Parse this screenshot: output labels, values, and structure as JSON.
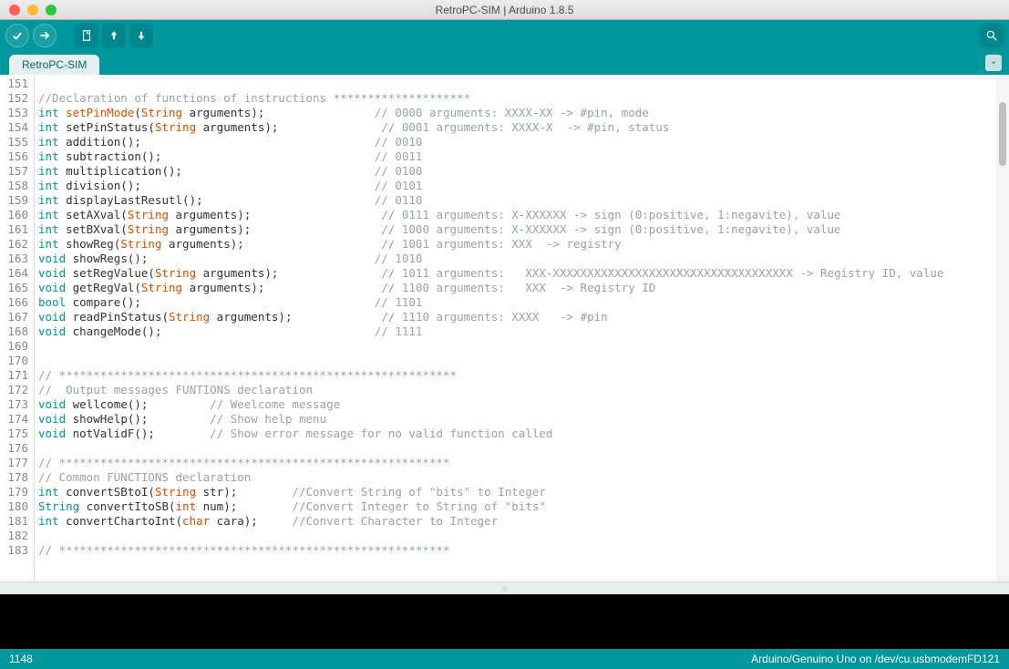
{
  "window": {
    "title": "RetroPC-SIM | Arduino 1.8.5"
  },
  "tab": {
    "name": "RetroPC-SIM"
  },
  "status": {
    "left": "1148",
    "right": "Arduino/Genuino Uno on /dev/cu.usbmodemFD121"
  },
  "first_line": 151,
  "code_lines": [
    {
      "plain": " "
    },
    {
      "cm": "//Declaration of functions of instructions ********************"
    },
    {
      "kw": "int",
      "plain": " ",
      "fn": "setPinMode",
      "after": "(",
      "tp": "String",
      "args": " arguments);",
      "spacer": "                ",
      "cm": "// 0000 arguments: XXXX-XX -> #pin, mode"
    },
    {
      "kw": "int",
      "plain": " setPinStatus(",
      "tp": "String",
      "args": " arguments);",
      "spacer": "               ",
      "cm": "// 0001 arguments: XXXX-X  -> #pin, status"
    },
    {
      "kw": "int",
      "plain": " addition();",
      "spacer": "                                  ",
      "cm": "// 0010"
    },
    {
      "kw": "int",
      "plain": " subtraction();",
      "spacer": "                               ",
      "cm": "// 0011"
    },
    {
      "kw": "int",
      "plain": " multiplication();",
      "spacer": "                            ",
      "cm": "// 0100"
    },
    {
      "kw": "int",
      "plain": " division();",
      "spacer": "                                  ",
      "cm": "// 0101"
    },
    {
      "kw": "int",
      "plain": " displayLastResutl();",
      "spacer": "                         ",
      "cm": "// 0110"
    },
    {
      "kw": "int",
      "plain": " setAXval(",
      "tp": "String",
      "args": " arguments);",
      "spacer": "                   ",
      "cm": "// 0111 arguments: X-XXXXXX -> sign (0:positive, 1:negavite), value"
    },
    {
      "kw": "int",
      "plain": " setBXval(",
      "tp": "String",
      "args": " arguments);",
      "spacer": "                   ",
      "cm": "// 1000 arguments: X-XXXXXX -> sign (0:positive, 1:negavite), value"
    },
    {
      "kw": "int",
      "plain": " showReg(",
      "tp": "String",
      "args": " arguments);",
      "spacer": "                    ",
      "cm": "// 1001 arguments: XXX  -> registry"
    },
    {
      "kw": "void",
      "plain": " showRegs();",
      "spacer": "                                 ",
      "cm": "// 1010"
    },
    {
      "kw": "void",
      "plain": " setRegValue(",
      "tp": "String",
      "args": " arguments);",
      "spacer": "               ",
      "cm": "// 1011 arguments:   XXX-XXXXXXXXXXXXXXXXXXXXXXXXXXXXXXXXXXX -> Registry ID, value"
    },
    {
      "kw": "void",
      "plain": " getRegVal(",
      "tp": "String",
      "args": " arguments);",
      "spacer": "                 ",
      "cm": "// 1100 arguments:   XXX  -> Registry ID"
    },
    {
      "kw": "bool",
      "plain": " compare();",
      "spacer": "                                  ",
      "cm": "// 1101"
    },
    {
      "kw": "void",
      "plain": " readPinStatus(",
      "tp": "String",
      "args": " arguments);",
      "spacer": "             ",
      "cm": "// 1110 arguments: XXXX   -> #pin"
    },
    {
      "kw": "void",
      "plain": " changeMode();",
      "spacer": "                               ",
      "cm": "// 1111"
    },
    {
      "plain": " "
    },
    {
      "plain": " "
    },
    {
      "cm": "// **********************************************************"
    },
    {
      "cm": "//  Output messages FUNTIONS declaration"
    },
    {
      "kw": "void",
      "plain": " wellcome();",
      "spacer": "         ",
      "cm": "// Weelcome message"
    },
    {
      "kw": "void",
      "plain": " showHelp();",
      "spacer": "         ",
      "cm": "// Show help menu"
    },
    {
      "kw": "void",
      "plain": " notValidF();",
      "spacer": "        ",
      "cm": "// Show error message for no valid function called"
    },
    {
      "plain": " "
    },
    {
      "cm": "// *********************************************************"
    },
    {
      "cm": "// Common FUNCTIONS declaration"
    },
    {
      "kw": "int",
      "plain": " convertSBtoI(",
      "tp": "String",
      "args": " str);",
      "spacer": "        ",
      "cm": "//Convert String of \"bits\" to Integer"
    },
    {
      "kw": "String",
      "plain": " convertItoSB(",
      "tp": "int",
      "args": " num);",
      "spacer": "        ",
      "cm": "//Convert Integer to String of \"bits\""
    },
    {
      "kw": "int",
      "plain": " convertChartoInt(",
      "tp": "char",
      "args": " cara);",
      "spacer": "     ",
      "cm": "//Convert Character to Integer"
    },
    {
      "plain": " "
    },
    {
      "cm": "// *********************************************************"
    }
  ]
}
